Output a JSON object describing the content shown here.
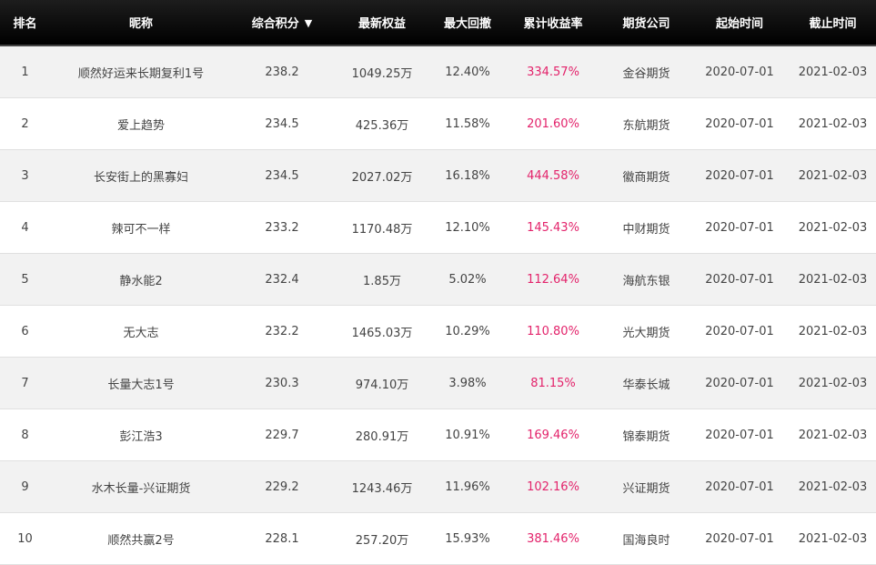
{
  "table": {
    "headers": {
      "rank": "排名",
      "nickname": "昵称",
      "score": "综合积分",
      "equity": "最新权益",
      "drawdown": "最大回撤",
      "return": "累计收益率",
      "broker": "期货公司",
      "start": "起始时间",
      "end": "截止时间"
    },
    "sort_icon": "triangle-down-icon",
    "return_color": "#e3236b",
    "rows": [
      {
        "rank": "1",
        "nickname": "顺然好运来长期复利1号",
        "score": "238.2",
        "equity": "1049.25万",
        "drawdown": "12.40%",
        "return": "334.57%",
        "broker": "金谷期货",
        "start": "2020-07-01",
        "end": "2021-02-03"
      },
      {
        "rank": "2",
        "nickname": "爱上趋势",
        "score": "234.5",
        "equity": "425.36万",
        "drawdown": "11.58%",
        "return": "201.60%",
        "broker": "东航期货",
        "start": "2020-07-01",
        "end": "2021-02-03"
      },
      {
        "rank": "3",
        "nickname": "长安街上的黑寡妇",
        "score": "234.5",
        "equity": "2027.02万",
        "drawdown": "16.18%",
        "return": "444.58%",
        "broker": "徽商期货",
        "start": "2020-07-01",
        "end": "2021-02-03"
      },
      {
        "rank": "4",
        "nickname": "辣可不一样",
        "score": "233.2",
        "equity": "1170.48万",
        "drawdown": "12.10%",
        "return": "145.43%",
        "broker": "中财期货",
        "start": "2020-07-01",
        "end": "2021-02-03"
      },
      {
        "rank": "5",
        "nickname": "静水能2",
        "score": "232.4",
        "equity": "1.85万",
        "drawdown": "5.02%",
        "return": "112.64%",
        "broker": "海航东银",
        "start": "2020-07-01",
        "end": "2021-02-03"
      },
      {
        "rank": "6",
        "nickname": "无大志",
        "score": "232.2",
        "equity": "1465.03万",
        "drawdown": "10.29%",
        "return": "110.80%",
        "broker": "光大期货",
        "start": "2020-07-01",
        "end": "2021-02-03"
      },
      {
        "rank": "7",
        "nickname": "长量大志1号",
        "score": "230.3",
        "equity": "974.10万",
        "drawdown": "3.98%",
        "return": "81.15%",
        "broker": "华泰长城",
        "start": "2020-07-01",
        "end": "2021-02-03"
      },
      {
        "rank": "8",
        "nickname": "彭江浩3",
        "score": "229.7",
        "equity": "280.91万",
        "drawdown": "10.91%",
        "return": "169.46%",
        "broker": "锦泰期货",
        "start": "2020-07-01",
        "end": "2021-02-03"
      },
      {
        "rank": "9",
        "nickname": "水木长量-兴证期货",
        "score": "229.2",
        "equity": "1243.46万",
        "drawdown": "11.96%",
        "return": "102.16%",
        "broker": "兴证期货",
        "start": "2020-07-01",
        "end": "2021-02-03"
      },
      {
        "rank": "10",
        "nickname": "顺然共赢2号",
        "score": "228.1",
        "equity": "257.20万",
        "drawdown": "15.93%",
        "return": "381.46%",
        "broker": "国海良时",
        "start": "2020-07-01",
        "end": "2021-02-03"
      }
    ]
  }
}
